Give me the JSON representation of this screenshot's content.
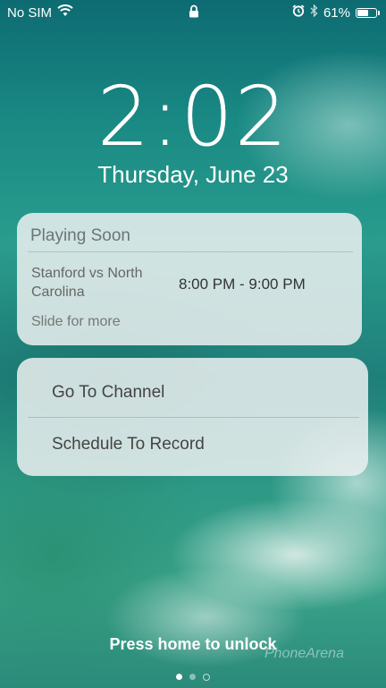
{
  "status_bar": {
    "carrier": "No SIM",
    "battery_percent": "61%",
    "battery_level": 0.61,
    "icons": [
      "wifi-icon",
      "lock-icon",
      "alarm-icon",
      "bluetooth-icon",
      "battery-icon"
    ]
  },
  "lockscreen": {
    "time": "2:02",
    "date": "Thursday, June 23",
    "unlock_hint": "Press home to unlock",
    "watermark": "PhoneArena"
  },
  "notification": {
    "title": "Playing Soon",
    "event": "Stanford vs North Carolina",
    "time_range": "8:00 PM - 9:00 PM",
    "more_hint": "Slide for more"
  },
  "actions": [
    {
      "label": "Go To Channel"
    },
    {
      "label": "Schedule To Record"
    }
  ],
  "page_indicator": {
    "count": 3,
    "active_index": 1
  }
}
